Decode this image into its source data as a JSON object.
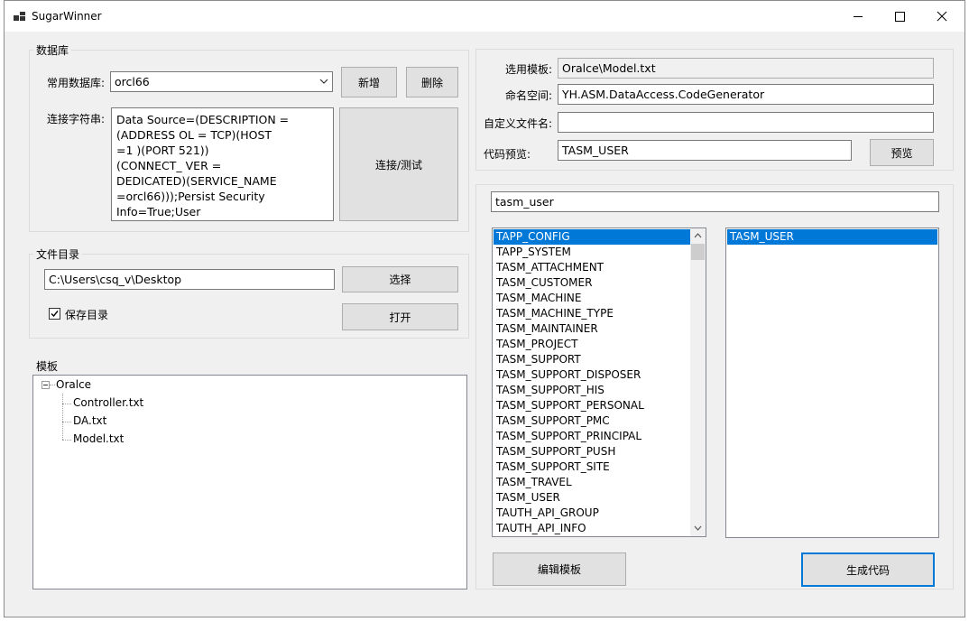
{
  "window": {
    "title": "SugarWinner"
  },
  "db_group": {
    "label": "数据库",
    "common_db_label": "常用数据库:",
    "common_db_value": "orcl66",
    "add_label": "新增",
    "delete_label": "删除",
    "conn_label": "连接字符串:",
    "conn_lines": [
      "Data Source=(DESCRIPTION =",
      "(ADDRESS            OL = TCP)(HOST",
      "=1              )(PORT      521))",
      "(CONNECT_          VER =",
      "DEDICATED)(SERVICE_NAME",
      "=orcl66)));Persist Security",
      "Info=True;User"
    ],
    "connect_label": "连接/测试"
  },
  "dir_group": {
    "label": "文件目录",
    "path_value": "C:\\Users\\csq_v\\Desktop",
    "select_label": "选择",
    "save_dir_label": "保存目录",
    "save_dir_checked": true,
    "open_label": "打开"
  },
  "tpl_group": {
    "label": "模板",
    "root": "Oralce",
    "children": [
      "Controller.txt",
      "DA.txt",
      "Model.txt"
    ]
  },
  "settings": {
    "template_label": "选用模板:",
    "template_value": "Oralce\\Model.txt",
    "namespace_label": "命名空间:",
    "namespace_value": "YH.ASM.DataAccess.CodeGenerator",
    "filename_label": "自定义文件名:",
    "filename_value": "",
    "preview_label": "代码预览:",
    "preview_value": "TASM_USER",
    "preview_button": "预览"
  },
  "tables": {
    "filter_value": "tasm_user",
    "all": [
      "TAPP_CONFIG",
      "TAPP_SYSTEM",
      "TASM_ATTACHMENT",
      "TASM_CUSTOMER",
      "TASM_MACHINE",
      "TASM_MACHINE_TYPE",
      "TASM_MAINTAINER",
      "TASM_PROJECT",
      "TASM_SUPPORT",
      "TASM_SUPPORT_DISPOSER",
      "TASM_SUPPORT_HIS",
      "TASM_SUPPORT_PERSONAL",
      "TASM_SUPPORT_PMC",
      "TASM_SUPPORT_PRINCIPAL",
      "TASM_SUPPORT_PUSH",
      "TASM_SUPPORT_SITE",
      "TASM_TRAVEL",
      "TASM_USER",
      "TAUTH_API_GROUP",
      "TAUTH_API_INFO"
    ],
    "selected_index": 0,
    "chosen": [
      "TASM_USER"
    ],
    "edit_template_label": "编辑模板",
    "generate_label": "生成代码"
  },
  "colors": {
    "accent": "#0078d7"
  }
}
